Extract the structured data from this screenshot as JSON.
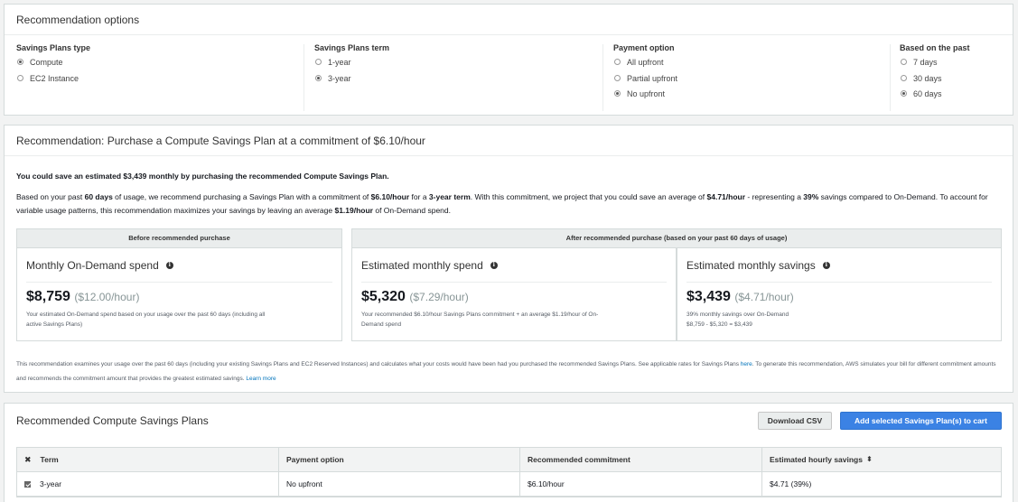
{
  "options_panel": {
    "title": "Recommendation options",
    "groups": [
      {
        "heading": "Savings Plans type",
        "options": [
          {
            "label": "Compute",
            "selected": true
          },
          {
            "label": "EC2 Instance",
            "selected": false
          }
        ]
      },
      {
        "heading": "Savings Plans term",
        "options": [
          {
            "label": "1-year",
            "selected": false
          },
          {
            "label": "3-year",
            "selected": true
          }
        ]
      },
      {
        "heading": "Payment option",
        "options": [
          {
            "label": "All upfront",
            "selected": false
          },
          {
            "label": "Partial upfront",
            "selected": false
          },
          {
            "label": "No upfront",
            "selected": true
          }
        ]
      },
      {
        "heading": "Based on the past",
        "options": [
          {
            "label": "7 days",
            "selected": false
          },
          {
            "label": "30 days",
            "selected": false
          },
          {
            "label": "60 days",
            "selected": true
          }
        ]
      }
    ]
  },
  "recommendation": {
    "title": "Recommendation: Purchase a Compute Savings Plan at a commitment of $6.10/hour",
    "summary": "You could save an estimated $3,439 monthly by purchasing the recommended Compute Savings Plan.",
    "para": {
      "t1": "Based on your past ",
      "b1": "60 days",
      "t2": " of usage, we recommend purchasing a Savings Plan with a commitment of ",
      "b2": "$6.10/hour",
      "t3": " for a ",
      "b3": "3-year term",
      "t4": ". With this commitment, we project that you could save an average of ",
      "b4": "$4.71/hour",
      "t5": " - representing a ",
      "b5": "39%",
      "t6": " savings compared to On-Demand. To account for variable usage patterns, this recommendation maximizes your savings by leaving an average ",
      "b6": "$1.19/hour",
      "t7": " of On-Demand spend."
    },
    "before_header": "Before recommended purchase",
    "after_header": "After recommended purchase (based on your past 60 days of usage)",
    "cards": [
      {
        "title": "Monthly On-Demand spend",
        "amount": "$8,759",
        "rate": "($12.00/hour)",
        "note1": "Your estimated On-Demand spend based on your usage over the past 60 days (including all",
        "note2": "active Savings Plans)"
      },
      {
        "title": "Estimated monthly spend",
        "amount": "$5,320",
        "rate": "($7.29/hour)",
        "note1": "Your recommended $6.10/hour Savings Plans commitment + an average $1.19/hour of On-",
        "note2": "Demand spend"
      },
      {
        "title": "Estimated monthly savings",
        "amount": "$3,439",
        "rate": "($4.71/hour)",
        "note1": "39% monthly savings over On-Demand",
        "note2": "$8,759 - $5,320 = $3,439"
      }
    ],
    "footer": {
      "t1": "This recommendation examines your usage over the past 60 days (including your existing Savings Plans and EC2 Reserved Instances) and calculates what your costs would have been had you purchased the recommended Savings Plans. See applicable rates for Savings Plans ",
      "here": "here",
      "t2": ". To generate this recommendation, AWS simulates your bill for different commitment amounts and recommends the commitment amount that provides the greatest estimated savings. ",
      "learn_more": "Learn more"
    }
  },
  "plans_panel": {
    "title": "Recommended Compute Savings Plans",
    "download_label": "Download CSV",
    "add_label": "Add selected Savings Plan(s) to cart",
    "columns": [
      "Term",
      "Payment option",
      "Recommended commitment",
      "Estimated hourly savings"
    ],
    "rows": [
      {
        "term": "3-year",
        "payment": "No upfront",
        "commitment": "$6.10/hour",
        "savings": "$4.71 (39%)"
      }
    ]
  }
}
